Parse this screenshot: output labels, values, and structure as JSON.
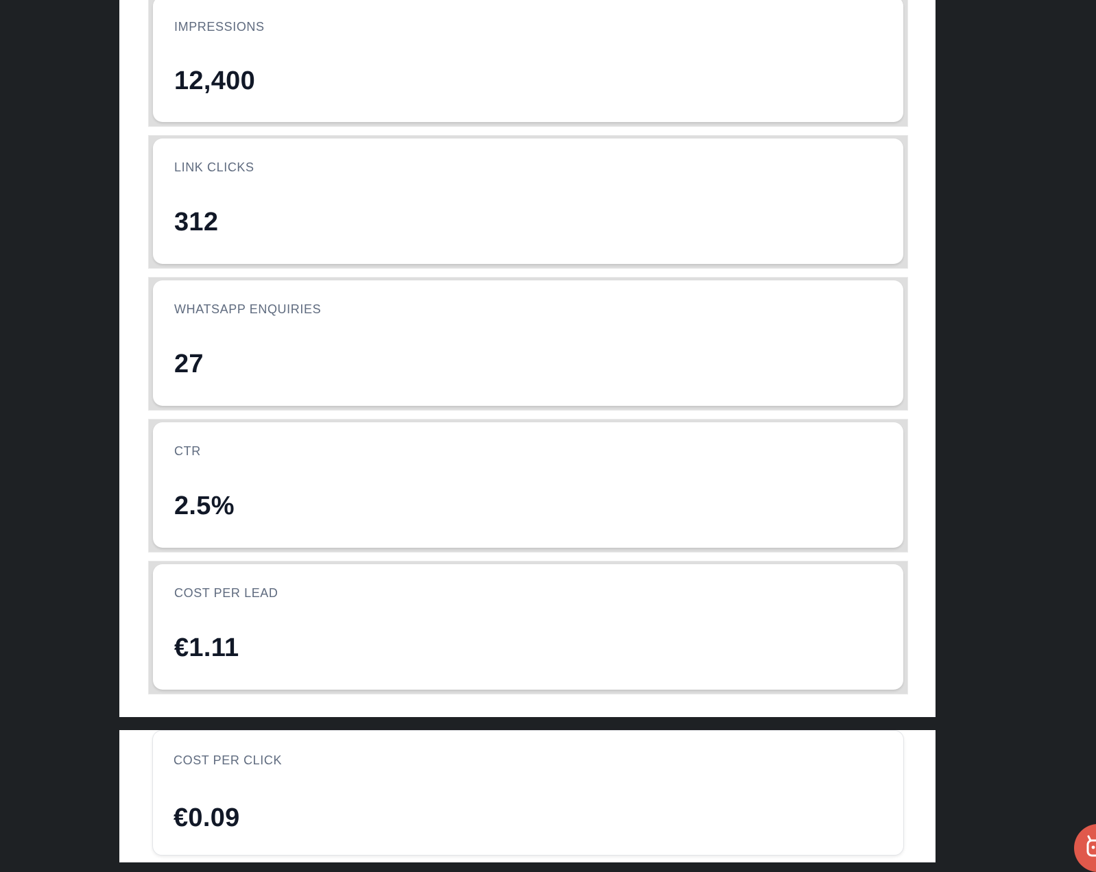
{
  "metrics": [
    {
      "label": "IMPRESSIONS",
      "value": "12,400"
    },
    {
      "label": "LINK CLICKS",
      "value": "312"
    },
    {
      "label": "WHATSAPP ENQUIRIES",
      "value": "27"
    },
    {
      "label": "CTR",
      "value": "2.5%"
    },
    {
      "label": "COST PER LEAD",
      "value": "€1.11"
    },
    {
      "label": "COST PER CLICK",
      "value": "€0.09"
    }
  ],
  "floating_button": {
    "icon": "assistant-icon",
    "color": "#e0594b"
  },
  "colors": {
    "backdrop": "#1e2124",
    "label": "#5f6b7f",
    "value": "#111827"
  }
}
